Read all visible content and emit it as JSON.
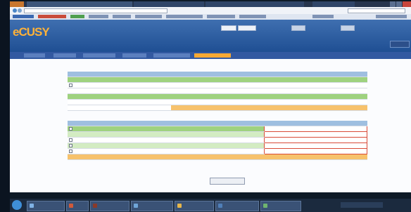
{
  "window": {
    "title": ""
  },
  "browser": {
    "address": "",
    "tabs_count": 4
  },
  "app": {
    "logo": "eCUSY",
    "menu": [
      {
        "label": ""
      },
      {
        "label": ""
      },
      {
        "label": ""
      },
      {
        "label": ""
      },
      {
        "label": ""
      },
      {
        "label": "",
        "active": true
      }
    ]
  },
  "page": {
    "breadcrumb": "",
    "table1": {
      "headers": [
        "",
        "",
        "",
        "",
        ""
      ],
      "rows": [
        {
          "style": "g",
          "cells": [
            "",
            "",
            "",
            "",
            ""
          ]
        },
        {
          "style": "w",
          "check": true,
          "cells": [
            "",
            "",
            "",
            "",
            ""
          ]
        },
        {
          "style": "w",
          "cells": [
            "",
            "",
            "",
            "",
            ""
          ]
        },
        {
          "style": "g",
          "cells": [
            "",
            "",
            "",
            "",
            ""
          ]
        },
        {
          "style": "w",
          "cells": [
            "",
            "",
            "",
            "",
            ""
          ]
        }
      ],
      "total": {
        "label": "",
        "value": ""
      }
    },
    "table2": {
      "headers": [
        "",
        "",
        ""
      ],
      "rows": [
        {
          "style": "g",
          "check": true,
          "cells": [
            "",
            "",
            ""
          ]
        },
        {
          "style": "lg",
          "check": false,
          "cells": [
            "",
            "",
            ""
          ]
        },
        {
          "style": "w",
          "check": true,
          "cells": [
            "",
            "",
            ""
          ]
        },
        {
          "style": "lg",
          "check": true,
          "cells": [
            "",
            "",
            ""
          ]
        },
        {
          "style": "w",
          "check": true,
          "cells": [
            "",
            "",
            ""
          ]
        }
      ],
      "total": {
        "label": "",
        "value1": "",
        "value2": ""
      }
    },
    "submit_label": ""
  },
  "taskbar": {
    "items": [
      {
        "icon": "app-icon",
        "color": "#7fb2e5"
      },
      {
        "icon": "app-icon",
        "color": "#d05a3a"
      },
      {
        "icon": "app-icon",
        "color": "#8a3a2a"
      },
      {
        "icon": "app-icon",
        "color": "#6fa6d8"
      },
      {
        "icon": "app-icon",
        "color": "#e6b64a"
      },
      {
        "icon": "app-icon",
        "color": "#4f7fb8"
      },
      {
        "icon": "app-icon",
        "color": "#6fb46f"
      }
    ],
    "clock": ""
  },
  "colors": {
    "header_blue": "#2f5fa3",
    "menu_active": "#f6a934",
    "row_green": "#9fd27f",
    "row_light_green": "#d3ecc2",
    "total_orange": "#f7c26c",
    "table_header": "#9fbfe0"
  }
}
